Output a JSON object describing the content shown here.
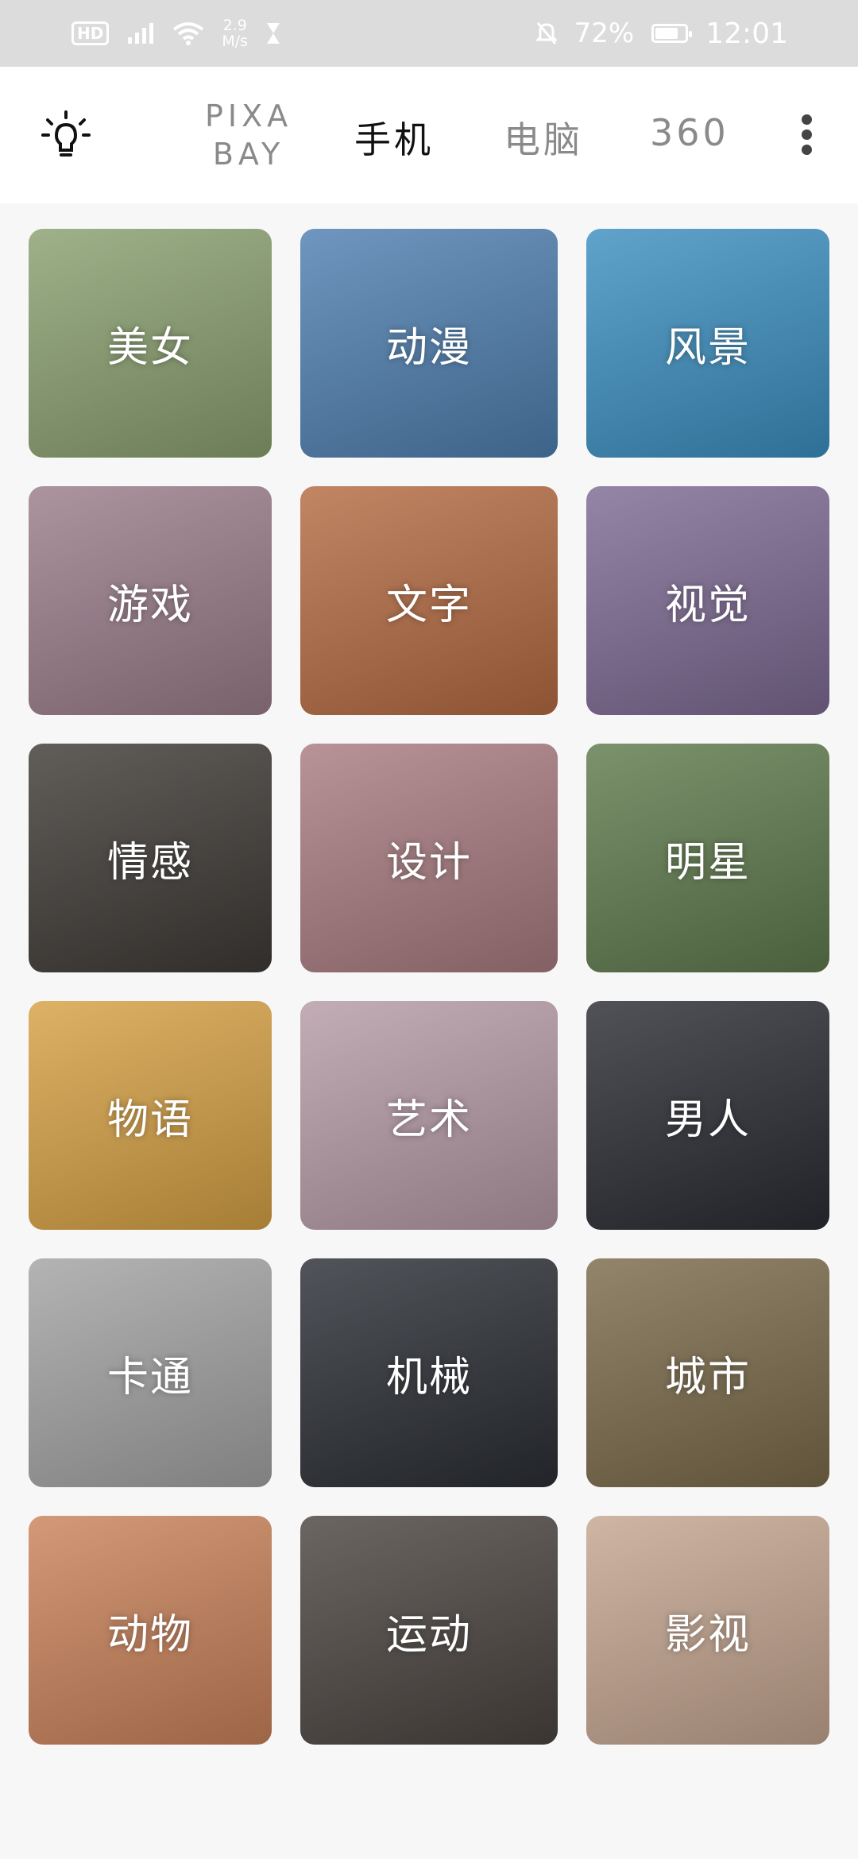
{
  "status_bar": {
    "network": "HD",
    "speed": "2.9\nM/s",
    "battery": "72%",
    "time": "12:01"
  },
  "tabs": [
    {
      "label": "PIXA\nBAY",
      "active": false
    },
    {
      "label": "手机",
      "active": true
    },
    {
      "label": "电脑",
      "active": false
    },
    {
      "label": "360",
      "active": false
    }
  ],
  "categories": [
    {
      "label": "美女",
      "bg": "#8aa070"
    },
    {
      "label": "动漫",
      "bg": "#4f7fb0"
    },
    {
      "label": "风景",
      "bg": "#3c8fc0"
    },
    {
      "label": "游戏",
      "bg": "#9a7d8a"
    },
    {
      "label": "文字",
      "bg": "#b46b42"
    },
    {
      "label": "视觉",
      "bg": "#7d6a93"
    },
    {
      "label": "情感",
      "bg": "#3e3a36"
    },
    {
      "label": "设计",
      "bg": "#a87b80"
    },
    {
      "label": "明星",
      "bg": "#5f7a4d"
    },
    {
      "label": "物语",
      "bg": "#d6a145"
    },
    {
      "label": "艺术",
      "bg": "#b59aa6"
    },
    {
      "label": "男人",
      "bg": "#2a2c33"
    },
    {
      "label": "卡通",
      "bg": "#a3a3a3"
    },
    {
      "label": "机械",
      "bg": "#2b2e35"
    },
    {
      "label": "城市",
      "bg": "#7a6a4a"
    },
    {
      "label": "动物",
      "bg": "#c9825a"
    },
    {
      "label": "运动",
      "bg": "#4a4440"
    },
    {
      "label": "影视",
      "bg": "#c4a590"
    }
  ]
}
